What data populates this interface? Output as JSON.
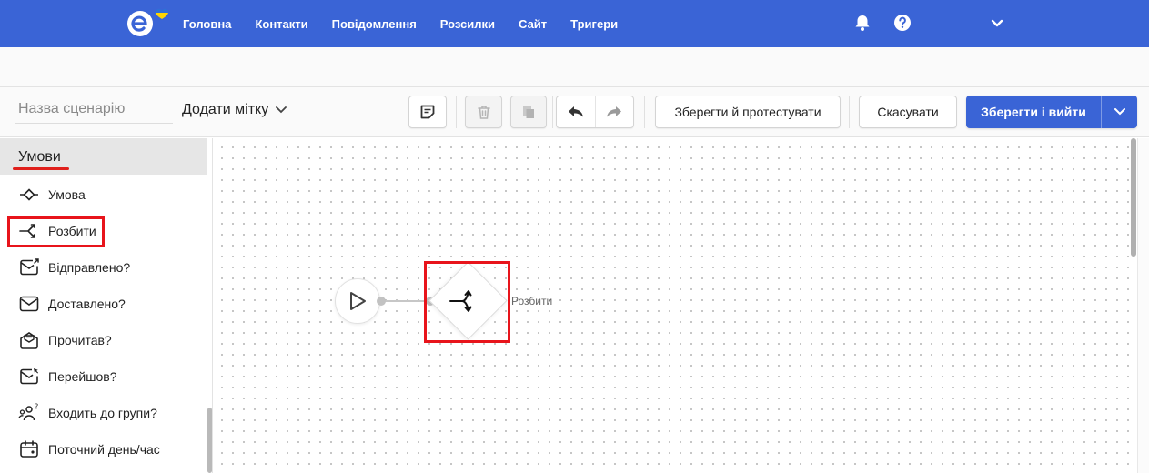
{
  "nav": {
    "items": [
      "Головна",
      "Контакти",
      "Повідомлення",
      "Розсилки",
      "Сайт",
      "Тригери"
    ],
    "icons": [
      "bell-icon",
      "help-icon",
      "chevron-down-icon"
    ]
  },
  "toolbar": {
    "scenario_placeholder": "Назва сценарію",
    "tag_label": "Додати мітку",
    "save_test_label": "Зберегти й протестувати",
    "cancel_label": "Скасувати",
    "save_exit_label": "Зберегти і вийти"
  },
  "sidebar": {
    "header": "Умови",
    "items": [
      {
        "label": "Умова",
        "icon": "condition-icon"
      },
      {
        "label": "Розбити",
        "icon": "split-icon"
      },
      {
        "label": "Відправлено?",
        "icon": "sent-mail-icon"
      },
      {
        "label": "Доставлено?",
        "icon": "delivered-mail-icon"
      },
      {
        "label": "Прочитав?",
        "icon": "read-mail-icon"
      },
      {
        "label": "Перейшов?",
        "icon": "clicked-mail-icon"
      },
      {
        "label": "Входить до групи?",
        "icon": "group-icon"
      },
      {
        "label": "Поточний день/час",
        "icon": "calendar-icon"
      }
    ]
  },
  "canvas": {
    "node_label": "Розбити"
  },
  "colors": {
    "brand": "#3a64d6",
    "highlight": "#e8141b",
    "ukraine_blue": "#2f6fd6",
    "ukraine_yellow": "#ffd500"
  }
}
